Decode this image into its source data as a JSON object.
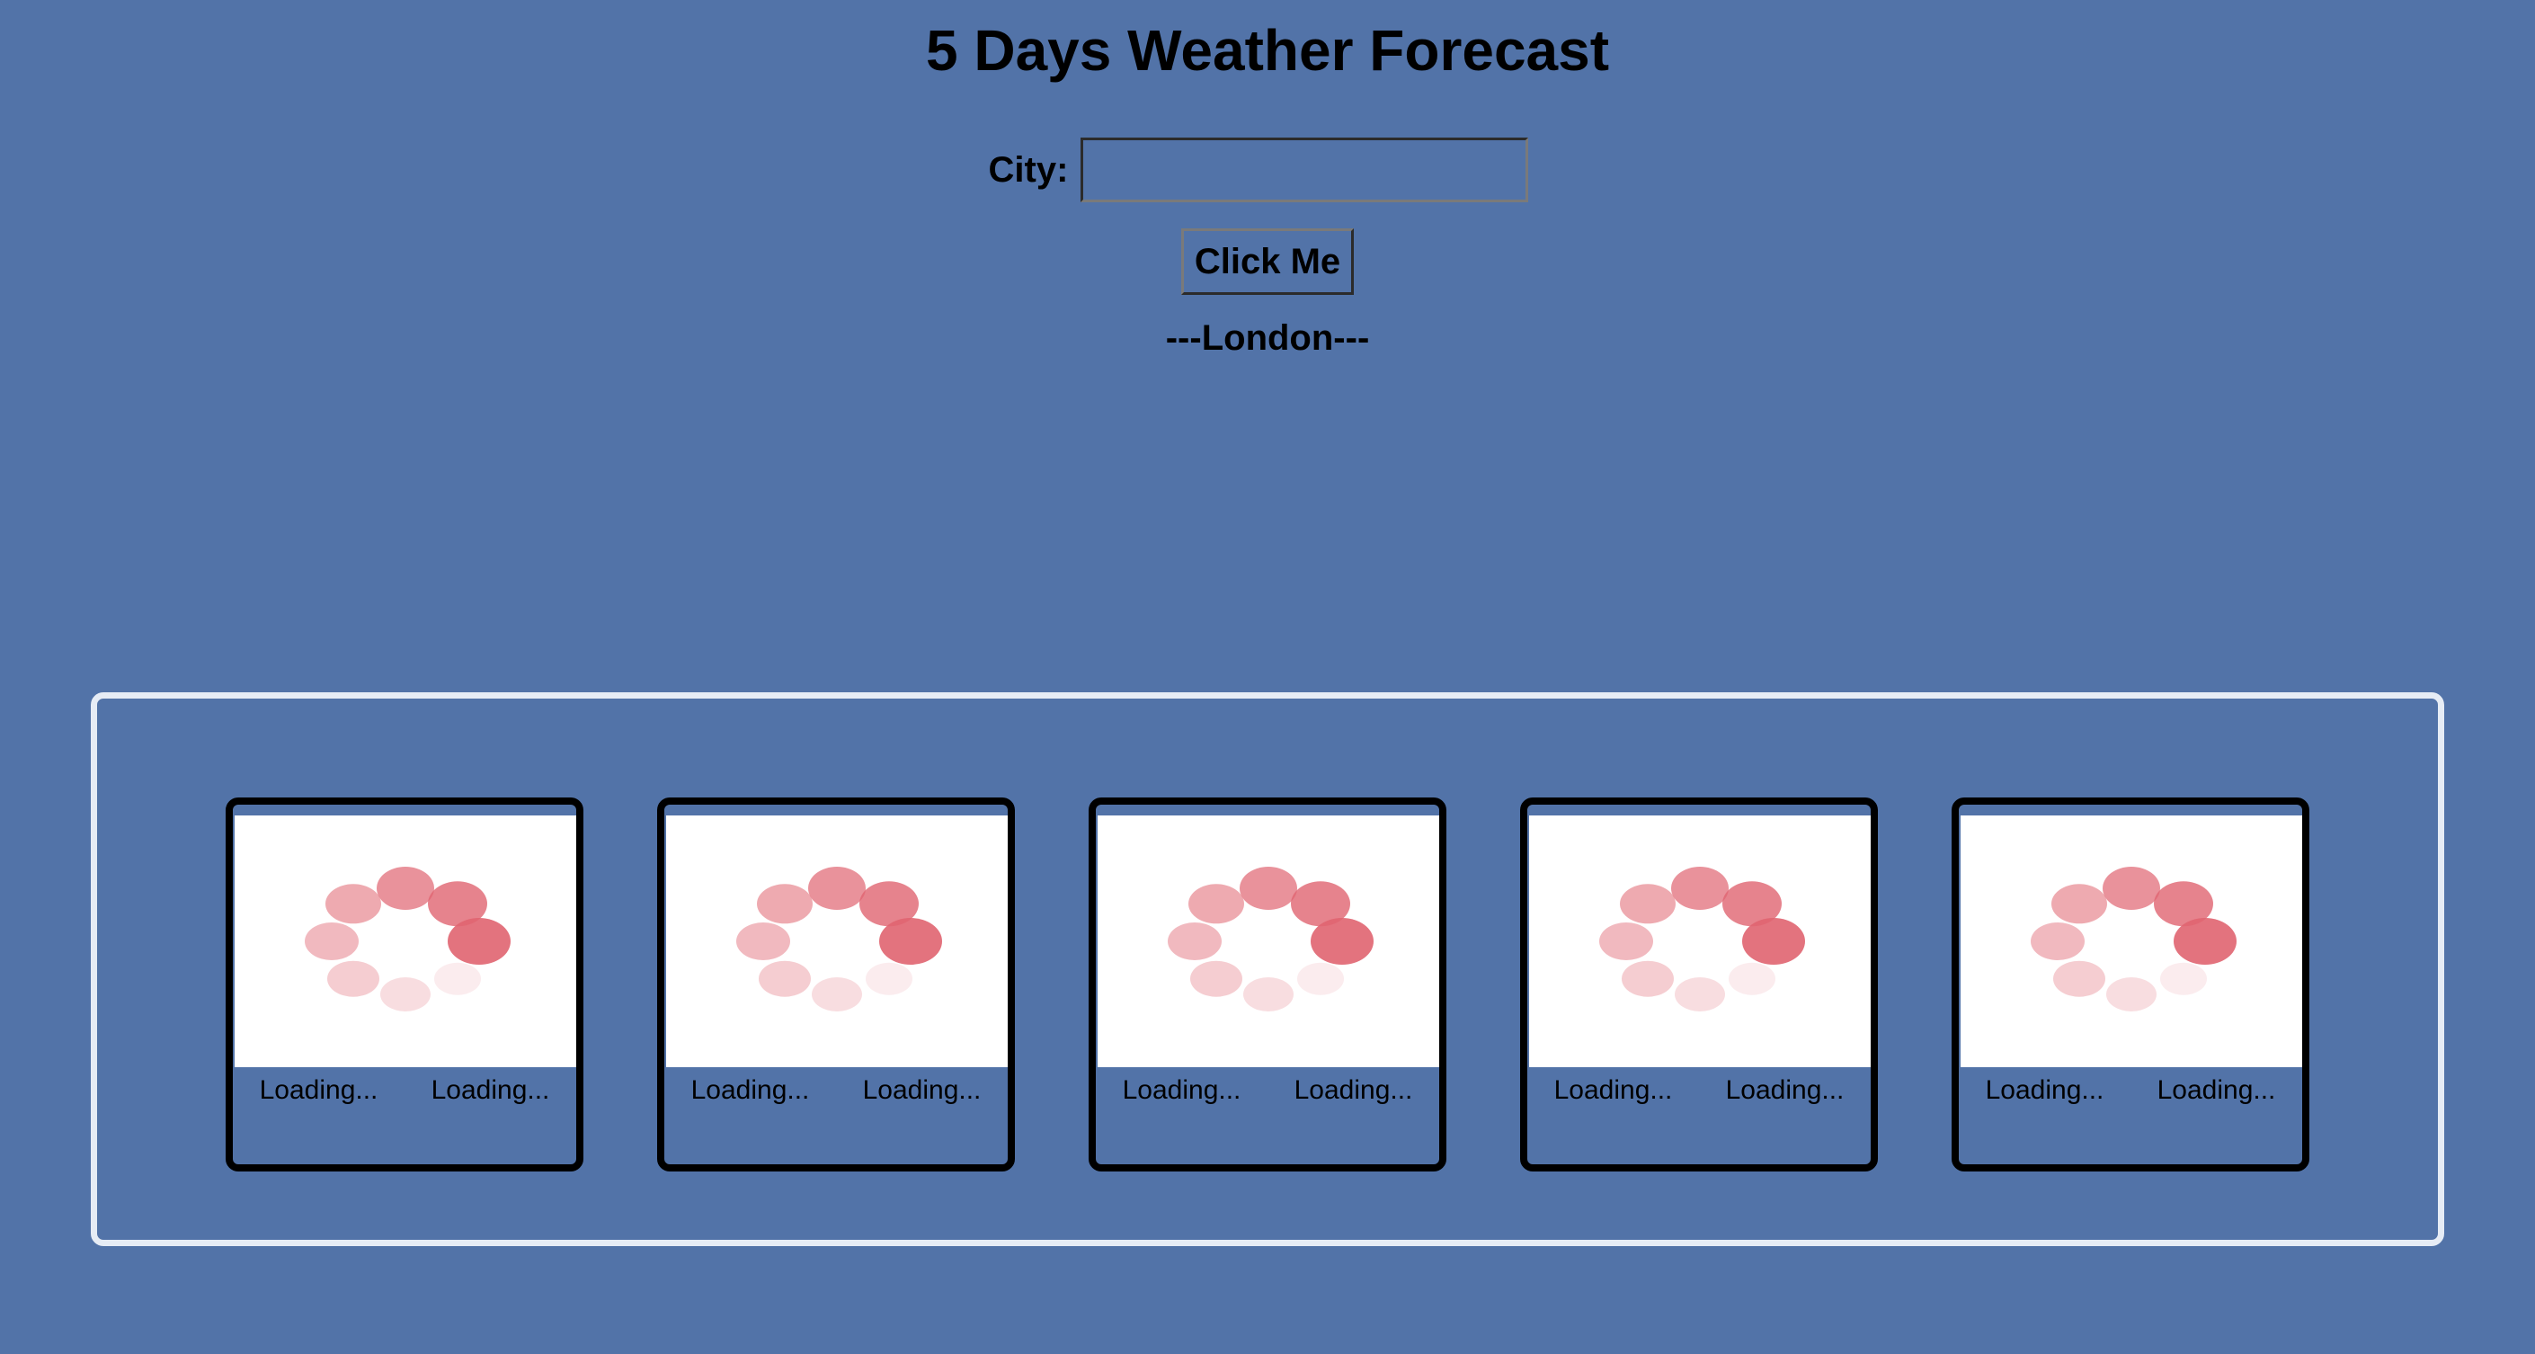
{
  "header": {
    "title": "5 Days Weather Forecast"
  },
  "search": {
    "city_label": "City:",
    "city_value": "",
    "city_placeholder": "",
    "button_label": "Click Me"
  },
  "location": {
    "city_display": "---London---"
  },
  "forecast": {
    "cards": [
      {
        "icon": "loading-spinner-icon",
        "label_left": "Loading...",
        "label_right": "Loading..."
      },
      {
        "icon": "loading-spinner-icon",
        "label_left": "Loading...",
        "label_right": "Loading..."
      },
      {
        "icon": "loading-spinner-icon",
        "label_left": "Loading...",
        "label_right": "Loading..."
      },
      {
        "icon": "loading-spinner-icon",
        "label_left": "Loading...",
        "label_right": "Loading..."
      },
      {
        "icon": "loading-spinner-icon",
        "label_left": "Loading...",
        "label_right": "Loading..."
      }
    ]
  },
  "colors": {
    "background": "#5273a8",
    "panel_border": "#e6ecf5",
    "card_border": "#000000",
    "spinner": "#e06470"
  }
}
